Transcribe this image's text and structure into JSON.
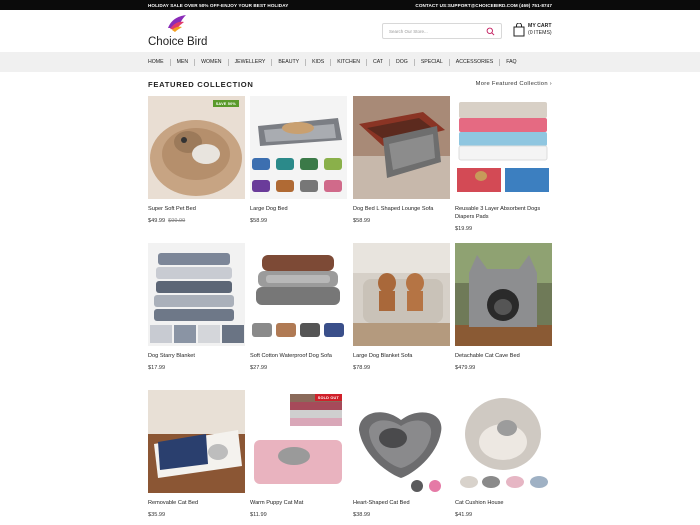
{
  "topbar": {
    "promo": "HOLIDAY SALE OVER 50% OFF-ENJOY YOUR BEST HOLIDAY",
    "contact": "CONTACT US:SUPPORT@CHOICEBIRD.COM (469) 751-8747"
  },
  "brand": {
    "name": "Choice Bird"
  },
  "search": {
    "placeholder": "Search Our Store..."
  },
  "cart": {
    "label": "MY CART",
    "items": "(0 ITEMS)"
  },
  "nav": [
    "HOME",
    "MEN",
    "WOMEN",
    "JEWELLERY",
    "BEAUTY",
    "KIDS",
    "KITCHEN",
    "CAT",
    "DOG",
    "SPECIAL",
    "ACCESSORIES",
    "FAQ"
  ],
  "section": {
    "title": "FEATURED COLLECTION",
    "more": "More Featured Collection ›"
  },
  "products": [
    {
      "name": "Super Soft Pet Bed",
      "price": "$49.99",
      "old_price": "$99.99",
      "badge": "SAVE 50%",
      "badge_color": "#5a9a2b"
    },
    {
      "name": "Large Dog Bed",
      "price": "$58.99"
    },
    {
      "name": "Dog Bed L Shaped Lounge Sofa",
      "price": "$58.99"
    },
    {
      "name": "Reusable 3 Layer Absorbent Dogs Diapers Pads",
      "price": "$19.99"
    },
    {
      "name": "Dog Starry Blanket",
      "price": "$17.99"
    },
    {
      "name": "Soft Cotton Waterproof Dog Sofa",
      "price": "$27.99"
    },
    {
      "name": "Large Dog Blanket Sofa",
      "price": "$78.99"
    },
    {
      "name": "Detachable Cat Cave Bed",
      "price": "$479.99"
    },
    {
      "name": "Removable Cat Bed",
      "price": "$35.99"
    },
    {
      "name": "Warm Puppy Cat Mat",
      "price": "$11.99",
      "badge": "SOLD OUT",
      "badge_color": "#d0202a"
    },
    {
      "name": "Heart-Shaped Cat Bed",
      "price": "$38.99"
    },
    {
      "name": "Cat Cushion House",
      "price": "$41.99"
    }
  ]
}
